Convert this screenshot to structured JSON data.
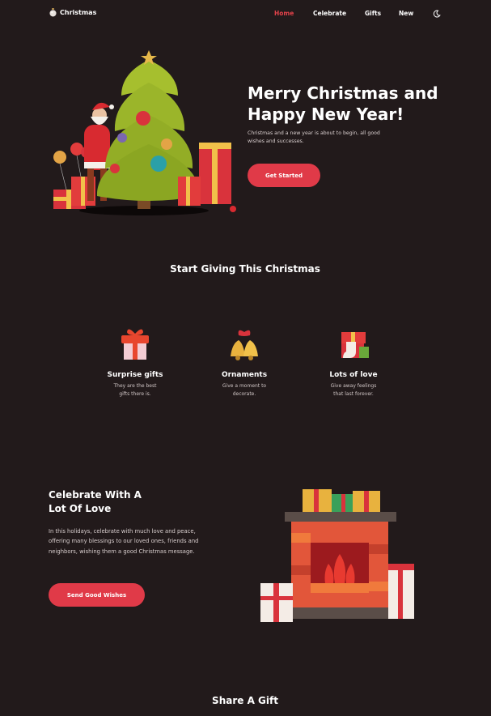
{
  "nav": {
    "brand": "Christmas",
    "brand_icon": "ornament-icon",
    "links": [
      {
        "label": "Home",
        "active": true
      },
      {
        "label": "Celebrate",
        "active": false
      },
      {
        "label": "Gifts",
        "active": false
      },
      {
        "label": "New",
        "active": false
      }
    ],
    "theme_icon": "moon-icon"
  },
  "hero": {
    "title": "Merry Christmas and Happy New Year!",
    "description": "Christmas and a new year is about to begin, all good wishes and successes.",
    "button": "Get Started",
    "image": "christmas-tree-santa-illustration"
  },
  "giving": {
    "title": "Start Giving This Christmas",
    "cards": [
      {
        "title": "Surprise gifts",
        "description": "They are the best gifts there is.",
        "icon": "gift-box-icon"
      },
      {
        "title": "Ornaments",
        "description": "Give a moment to decorate.",
        "icon": "bells-icon"
      },
      {
        "title": "Lots of love",
        "description": "Give away feelings that last forever.",
        "icon": "stocking-gifts-icon"
      }
    ]
  },
  "celebrate": {
    "title": "Celebrate With A Lot Of Love",
    "description": "In this holidays, celebrate with much love and peace, offering many blessings to our loved ones, friends and neighbors, wishing them a good Christmas message.",
    "button": "Send Good Wishes",
    "image": "fireplace-illustration"
  },
  "share": {
    "title": "Share A Gift"
  },
  "colors": {
    "background": "#221a1b",
    "accent": "#e03a48",
    "text": "#ffffff"
  }
}
